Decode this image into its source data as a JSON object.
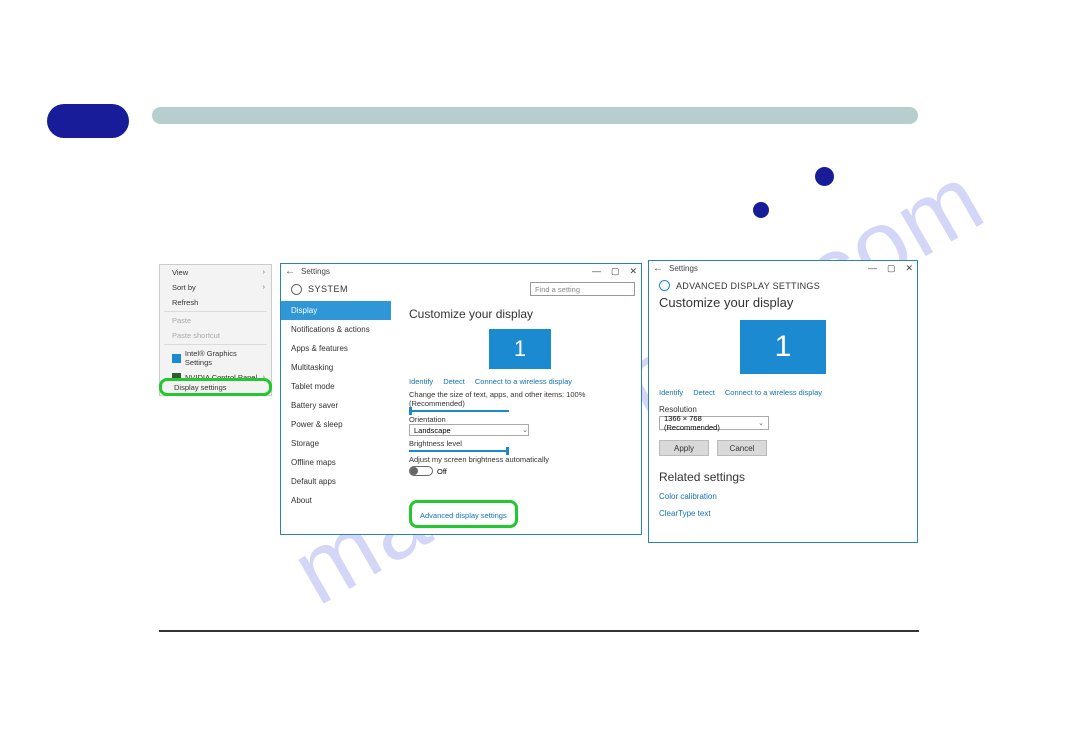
{
  "watermark": "manualshive.com",
  "context_menu": {
    "view": "View",
    "sort_by": "Sort by",
    "refresh": "Refresh",
    "paste": "Paste",
    "paste_shortcut": "Paste shortcut",
    "intel_gfx": "Intel® Graphics Settings",
    "nvidia_cp": "NVIDIA Control Panel",
    "display_settings": "Display settings"
  },
  "settings": {
    "window_title": "Settings",
    "back_arrow": "←",
    "system_label": "SYSTEM",
    "search_placeholder": "Find a setting",
    "sidebar": [
      "Display",
      "Notifications & actions",
      "Apps & features",
      "Multitasking",
      "Tablet mode",
      "Battery saver",
      "Power & sleep",
      "Storage",
      "Offline maps",
      "Default apps",
      "About"
    ],
    "heading": "Customize your display",
    "monitor_number": "1",
    "identify": "Identify",
    "detect": "Detect",
    "connect_wireless": "Connect to a wireless display",
    "scale_caption": "Change the size of text, apps, and other items: 100% (Recommended)",
    "orientation_label": "Orientation",
    "orientation_value": "Landscape",
    "brightness_label": "Brightness level",
    "auto_brightness_label": "Adjust my screen brightness automatically",
    "toggle_state": "Off",
    "advanced_link": "Advanced display settings"
  },
  "advanced": {
    "window_title": "Settings",
    "header": "ADVANCED DISPLAY SETTINGS",
    "heading": "Customize your display",
    "monitor_number": "1",
    "identify": "Identify",
    "detect": "Detect",
    "connect_wireless": "Connect to a wireless display",
    "resolution_label": "Resolution",
    "resolution_value": "1366 × 768 (Recommended)",
    "apply": "Apply",
    "cancel": "Cancel",
    "related_heading": "Related settings",
    "color_calibration": "Color calibration",
    "cleartype": "ClearType text"
  },
  "window": {
    "min": "—",
    "max": "▢",
    "close": "✕"
  }
}
